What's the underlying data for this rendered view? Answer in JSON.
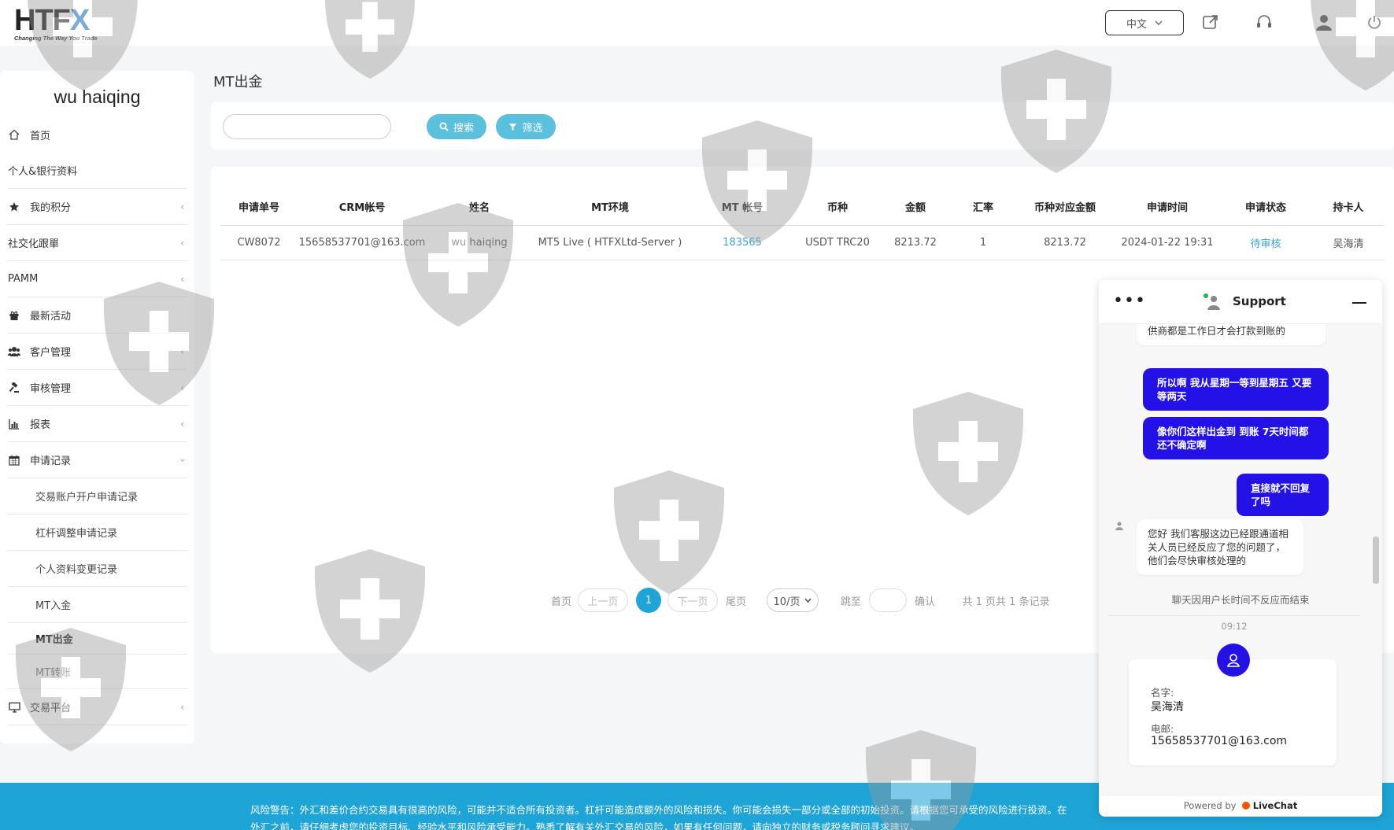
{
  "header": {
    "logo_text": "HTFX",
    "logo_tagline": "Changing The Way You Trade",
    "language": "中文"
  },
  "sidebar": {
    "user_name": "wu haiqing",
    "items": [
      {
        "label": "首页",
        "icon": "home-icon"
      },
      {
        "label": "个人&银行资料",
        "icon": ""
      },
      {
        "label": "我的积分",
        "icon": "star-icon"
      },
      {
        "label": "社交化跟單",
        "icon": ""
      },
      {
        "label": "PAMM",
        "icon": ""
      },
      {
        "label": "最新活动",
        "icon": "gift-icon"
      },
      {
        "label": "客户管理",
        "icon": "users-icon"
      },
      {
        "label": "审核管理",
        "icon": "gavel-icon"
      },
      {
        "label": "报表",
        "icon": "chart-icon"
      },
      {
        "label": "申请记录",
        "icon": "calendar-icon"
      }
    ],
    "sub_items": [
      "交易账户开户申请记录",
      "杠杆调整申请记录",
      "个人资料变更记录",
      "MT入金",
      "MT出金",
      "MT转账"
    ],
    "last_item": "交易平台"
  },
  "main": {
    "title": "MT出金",
    "search": {
      "placeholder": "",
      "search_label": "搜索",
      "filter_label": "筛选"
    }
  },
  "table": {
    "headers": [
      "申请单号",
      "CRM帐号",
      "姓名",
      "MT环境",
      "MT 帐号",
      "币种",
      "金额",
      "汇率",
      "币种对应金额",
      "申请时间",
      "申请状态",
      "持卡人"
    ],
    "rows": [
      [
        "CW8072",
        "15658537701@163.com",
        "wu haiqing",
        "MT5 Live ( HTFXLtd-Server )",
        "183565",
        "USDT TRC20",
        "8213.72",
        "1",
        "8213.72",
        "2024-01-22 19:31",
        "待审核",
        "吴海清"
      ]
    ]
  },
  "pagination": {
    "first": "首页",
    "prev": "上一页",
    "current": "1",
    "next": "下一页",
    "last": "尾页",
    "per_page": "10/页",
    "jump_label": "跳至",
    "confirm": "确认",
    "summary": "共 1 页共 1 条记录"
  },
  "footer": {
    "line1": "风险警告：外汇和差价合约交易具有很高的风险，可能并不适合所有投资者。杠杆可能造成额外的风险和损失。你可能会损失一部分或全部的初始投资。请根据您可承受的风险进行投资。在",
    "line2": "外汇之前，请仔细考虑您的投资目标、经验水平和风险承受能力。熟悉了解有关外汇交易的风险，如果有任何问题，请向独立的财务或税务顾问寻求建议。"
  },
  "chat": {
    "title": "Support",
    "msg_top": "供商都是工作日才会打款到账的",
    "out1": "所以啊 我从星期一等到星期五 又要等两天",
    "out2": "像你们这样出金到 到账 7天时间都还不确定啊",
    "out3": "直接就不回复了吗",
    "in1": "您好 我们客服这边已经跟通道相关人员已经反应了您的问题了，他们会尽快审核处理的",
    "system": "聊天因用户长时间不反应而结束",
    "time": "09:12",
    "card_name_label": "名字:",
    "card_name": "吴海清",
    "card_email_label": "电邮:",
    "card_email": "15658537701@163.com",
    "powered_by": "Powered by",
    "brand": "LiveChat"
  },
  "colors": {
    "accent": "#5bc0de",
    "pager_active": "#1ea4d6",
    "footer_bg": "#1ea4d6",
    "chat_bubble_out": "#2411e6",
    "link": "#3aa3d8"
  }
}
